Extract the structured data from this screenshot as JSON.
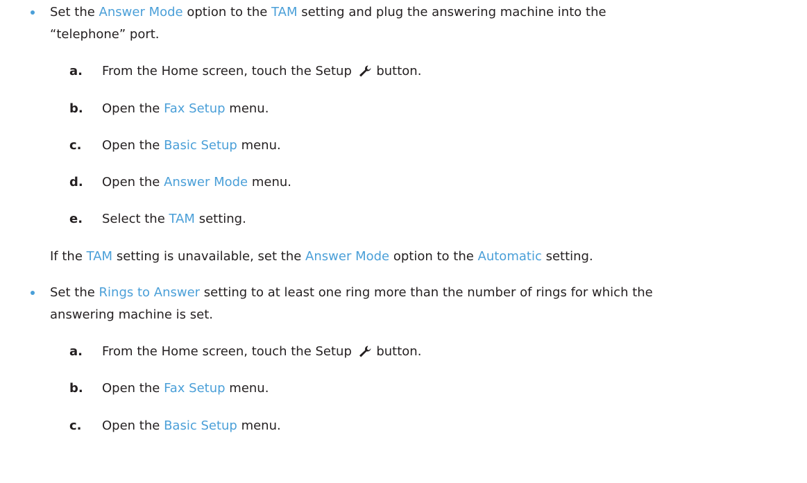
{
  "bullet1": {
    "line1_pre": "Set the ",
    "link_answer_mode": "Answer Mode",
    "line1_mid": " option to the ",
    "link_tam": "TAM",
    "line1_post": " setting and plug the answering machine into the",
    "line2": "“telephone” port."
  },
  "steps1": [
    {
      "marker": "a.",
      "text_pre": "From the Home screen, touch the Setup ",
      "text_post": " button."
    },
    {
      "marker": "b.",
      "text_pre": "Open the ",
      "link": "Fax Setup",
      "text_post": " menu."
    },
    {
      "marker": "c.",
      "text_pre": "Open the ",
      "link": "Basic Setup",
      "text_post": " menu."
    },
    {
      "marker": "d.",
      "text_pre": "Open the ",
      "link": "Answer Mode",
      "text_post": " menu."
    },
    {
      "marker": "e.",
      "text_pre": "Select the ",
      "link": "TAM",
      "text_post": " setting."
    }
  ],
  "note": {
    "pre": "If the ",
    "link_tam": "TAM",
    "mid1": " setting is unavailable, set the ",
    "link_answer_mode": "Answer Mode",
    "mid2": " option to the ",
    "link_automatic": "Automatic",
    "post": " setting."
  },
  "bullet2": {
    "line1_pre": "Set the ",
    "link_rings": "Rings to Answer",
    "line1_post": " setting to at least one ring more than the number of rings for which the",
    "line2": "answering machine is set."
  },
  "steps2": [
    {
      "marker": "a.",
      "text_pre": "From the Home screen, touch the Setup ",
      "text_post": " button."
    },
    {
      "marker": "b.",
      "text_pre": "Open the ",
      "link": "Fax Setup",
      "text_post": " menu."
    },
    {
      "marker": "c.",
      "text_pre": "Open the ",
      "link": "Basic Setup",
      "text_post": " menu."
    }
  ],
  "icons": {
    "setup": "wrench-icon"
  },
  "colors": {
    "link": "#4a9fd8",
    "bullet": "#4a9fd8",
    "text": "#231f20"
  }
}
